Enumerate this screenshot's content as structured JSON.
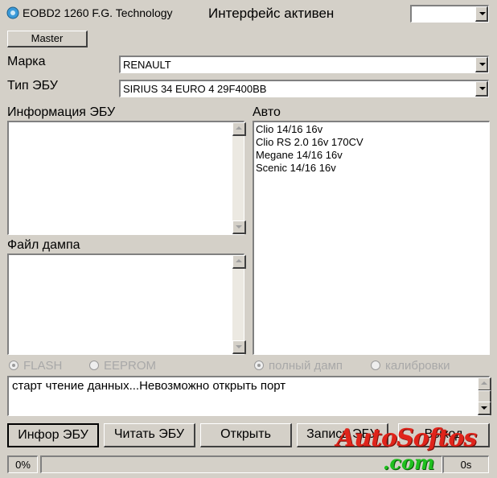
{
  "app": {
    "title": "EOBD2 1260 F.G. Technology",
    "status": "Интерфейс активен"
  },
  "port_select": {
    "value": ""
  },
  "master_button": {
    "label": "Master"
  },
  "make": {
    "label": "Марка",
    "value": "RENAULT"
  },
  "ecu_type": {
    "label": "Тип ЭБУ",
    "value": "SIRIUS 34 EURO 4 29F400BB"
  },
  "ecu_info": {
    "label": "Информация ЭБУ",
    "text": ""
  },
  "dump_file": {
    "label": "Файл дампа",
    "text": ""
  },
  "auto": {
    "label": "Авто",
    "items": [
      "Clio 14/16  16v",
      "Clio RS 2.0 16v 170CV",
      "Megane 14/16  16v",
      "Scenic 14/16  16v"
    ]
  },
  "memory_type": {
    "flash": "FLASH",
    "eeprom": "EEPROM",
    "selected": "FLASH"
  },
  "dump_type": {
    "full": "полный дамп",
    "calibration": "калибровки",
    "selected": "полный дамп"
  },
  "log": {
    "text": "старт чтение данных...Невозможно открыть порт"
  },
  "buttons": {
    "info": "Инфор ЭБУ",
    "read": "Читать ЭБУ",
    "open": "Открыть",
    "write": "Запись ЭБУ",
    "exit": "Выход"
  },
  "progress": {
    "percent_label": "0%",
    "value": 0,
    "time_label": "0s"
  },
  "watermark": {
    "text1": "AutoSoftos",
    "text2": ".com"
  }
}
